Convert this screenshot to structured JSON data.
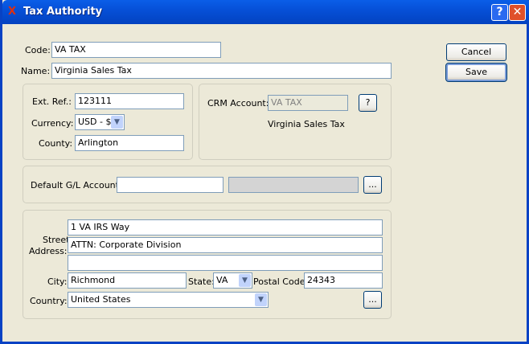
{
  "window": {
    "title": "Tax Authority",
    "help_label": "?",
    "close_label": "✕"
  },
  "form": {
    "code_label": "Code:",
    "code": "VA TAX",
    "name_label": "Name:",
    "name": "Virginia Sales Tax",
    "ext_ref_label": "Ext. Ref.:",
    "ext_ref": "123111",
    "currency_label": "Currency:",
    "currency": "USD - $",
    "county_label": "County:",
    "county": "Arlington",
    "crm_label": "CRM Account:",
    "crm_account": "VA TAX",
    "crm_help": "?",
    "crm_name": "Virginia Sales Tax",
    "gl_label": "Default G/L Account:",
    "gl_account": "",
    "gl_desc": "",
    "gl_browse": "...",
    "street_label_1": "Street",
    "street_label_2": "Address:",
    "address1": "1 VA IRS Way",
    "address2": "ATTN: Corporate Division",
    "address3": "",
    "city_label": "City:",
    "city": "Richmond",
    "state_label": "State:",
    "state": "VA",
    "postal_label": "Postal Code:",
    "postal": "24343",
    "country_label": "Country:",
    "country": "United States",
    "address_browse": "..."
  },
  "buttons": {
    "cancel": "Cancel",
    "save": "Save"
  }
}
